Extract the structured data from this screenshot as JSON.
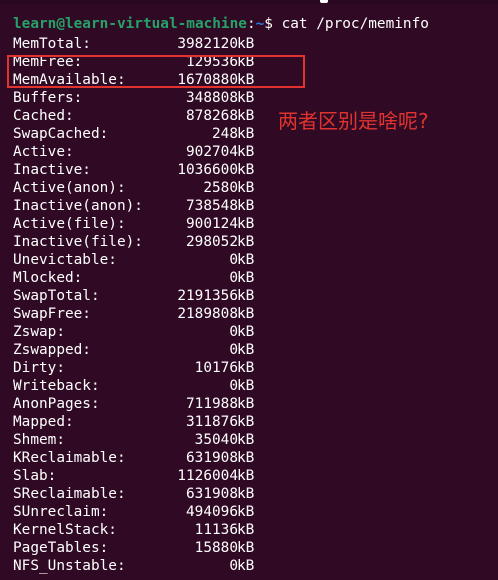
{
  "terminal": {
    "prompt": {
      "user_host": "learn@learn-virtual-machine",
      "separator": ":",
      "path": "~",
      "dollar": "$ ",
      "command": "cat /proc/meminfo"
    },
    "rows": [
      {
        "key": "MemTotal:",
        "value": "3982120",
        "unit": "kB"
      },
      {
        "key": "MemFree:",
        "value": "129536",
        "unit": "kB"
      },
      {
        "key": "MemAvailable:",
        "value": "1670880",
        "unit": "kB"
      },
      {
        "key": "Buffers:",
        "value": "348808",
        "unit": "kB"
      },
      {
        "key": "Cached:",
        "value": "878268",
        "unit": "kB"
      },
      {
        "key": "SwapCached:",
        "value": "248",
        "unit": "kB"
      },
      {
        "key": "Active:",
        "value": "902704",
        "unit": "kB"
      },
      {
        "key": "Inactive:",
        "value": "1036600",
        "unit": "kB"
      },
      {
        "key": "Active(anon):",
        "value": "2580",
        "unit": "kB"
      },
      {
        "key": "Inactive(anon):",
        "value": "738548",
        "unit": "kB"
      },
      {
        "key": "Active(file):",
        "value": "900124",
        "unit": "kB"
      },
      {
        "key": "Inactive(file):",
        "value": "298052",
        "unit": "kB"
      },
      {
        "key": "Unevictable:",
        "value": "0",
        "unit": "kB"
      },
      {
        "key": "Mlocked:",
        "value": "0",
        "unit": "kB"
      },
      {
        "key": "SwapTotal:",
        "value": "2191356",
        "unit": "kB"
      },
      {
        "key": "SwapFree:",
        "value": "2189808",
        "unit": "kB"
      },
      {
        "key": "Zswap:",
        "value": "0",
        "unit": "kB"
      },
      {
        "key": "Zswapped:",
        "value": "0",
        "unit": "kB"
      },
      {
        "key": "Dirty:",
        "value": "10176",
        "unit": "kB"
      },
      {
        "key": "Writeback:",
        "value": "0",
        "unit": "kB"
      },
      {
        "key": "AnonPages:",
        "value": "711988",
        "unit": "kB"
      },
      {
        "key": "Mapped:",
        "value": "311876",
        "unit": "kB"
      },
      {
        "key": "Shmem:",
        "value": "35040",
        "unit": "kB"
      },
      {
        "key": "KReclaimable:",
        "value": "631908",
        "unit": "kB"
      },
      {
        "key": "Slab:",
        "value": "1126004",
        "unit": "kB"
      },
      {
        "key": "SReclaimable:",
        "value": "631908",
        "unit": "kB"
      },
      {
        "key": "SUnreclaim:",
        "value": "494096",
        "unit": "kB"
      },
      {
        "key": "KernelStack:",
        "value": "11136",
        "unit": "kB"
      },
      {
        "key": "PageTables:",
        "value": "15880",
        "unit": "kB"
      },
      {
        "key": "NFS_Unstable:",
        "value": "0",
        "unit": "kB"
      }
    ]
  },
  "annotation": {
    "text": "两者区别是啥呢?",
    "color": "#e0332f"
  },
  "colors": {
    "background": "#300a24",
    "user_host": "#26a269",
    "path": "#2a7bde",
    "text": "#ffffff",
    "highlight": "#e0332f"
  }
}
